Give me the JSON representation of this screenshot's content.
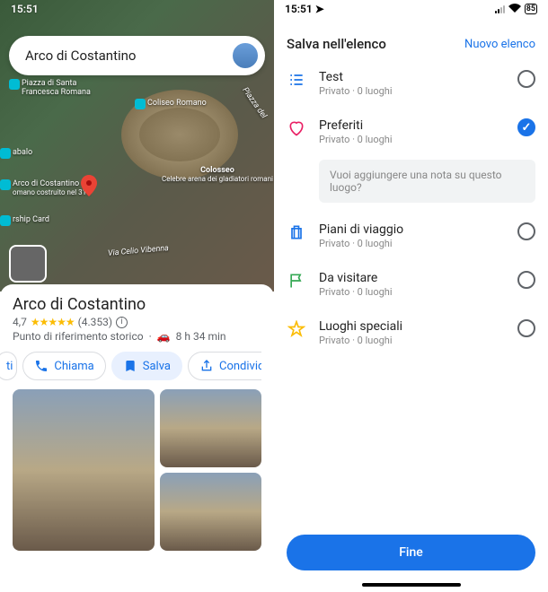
{
  "left": {
    "status": {
      "time": "15:51",
      "location_arrow": "◤"
    },
    "search": {
      "text": "Arco di Costantino"
    },
    "map_labels": {
      "piazza": "Piazza di Santa\nFrancesca Romana",
      "coliseo": "Coliseo Romano",
      "colosseo": "Colosseo",
      "colosseo_sub": "Celebre arena dei gladiatori romani",
      "abalo": "abalo",
      "arco": "Arco di Costantino",
      "arco_sub": "omano costruito nel 315",
      "rship": "rship Card",
      "via_celio": "Via Celio Vibenna",
      "piazza_del": "Piazza del"
    },
    "place": {
      "title": "Arco di Costantino",
      "rating": "4,7",
      "stars": "★★★★★",
      "reviews": "(4.353)",
      "category": "Punto di riferimento storico",
      "eta": "8 h 34 min"
    },
    "chips": {
      "frag_left": "ti",
      "call": "Chiama",
      "save": "Salva",
      "share": "Condividi",
      "frag_right": ""
    }
  },
  "right": {
    "status": {
      "time": "15:51",
      "battery": "85"
    },
    "header": {
      "title": "Salva nell'elenco",
      "new": "Nuovo elenco"
    },
    "note_placeholder": "Vuoi aggiungere una nota su questo luogo?",
    "lists": [
      {
        "key": "test",
        "name": "Test",
        "meta": "Privato · 0 luoghi",
        "icon": "list",
        "color": "#1a73e8",
        "checked": false
      },
      {
        "key": "preferiti",
        "name": "Preferiti",
        "meta": "Privato · 0 luoghi",
        "icon": "heart",
        "color": "#e91e63",
        "checked": true
      },
      {
        "key": "piani",
        "name": "Piani di viaggio",
        "meta": "Privato · 0 luoghi",
        "icon": "suitcase",
        "color": "#1a73e8",
        "checked": false
      },
      {
        "key": "visitare",
        "name": "Da visitare",
        "meta": "Privato · 0 luoghi",
        "icon": "flag",
        "color": "#34a853",
        "checked": false
      },
      {
        "key": "speciali",
        "name": "Luoghi speciali",
        "meta": "Privato · 0 luoghi",
        "icon": "star",
        "color": "#fbbc04",
        "checked": false
      }
    ],
    "done": "Fine"
  }
}
